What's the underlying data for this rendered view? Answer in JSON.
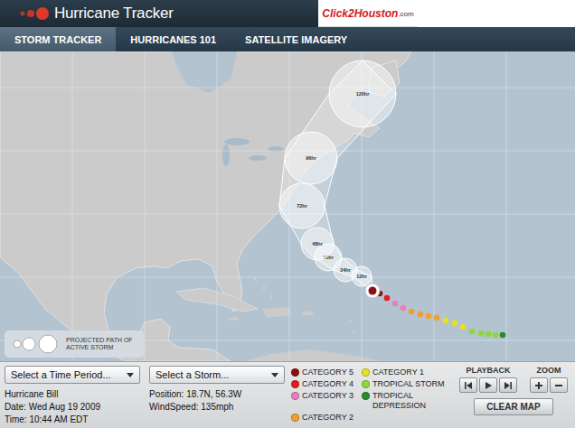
{
  "header": {
    "title": "Hurricane Tracker",
    "logo": {
      "main": "Click2Houston",
      "suffix": ".com"
    }
  },
  "tabs": [
    {
      "label": "STORM TRACKER",
      "selected": true
    },
    {
      "label": "HURRICANES 101",
      "selected": false
    },
    {
      "label": "SATELLITE IMAGERY",
      "selected": false
    }
  ],
  "map": {
    "forecast": [
      {
        "label": "12hr"
      },
      {
        "label": "24hr"
      },
      {
        "label": "36hr"
      },
      {
        "label": "48hr"
      },
      {
        "label": "72hr"
      },
      {
        "label": "96hr"
      },
      {
        "label": "120hr"
      }
    ],
    "track": [
      {
        "color": "#2c8a2c"
      },
      {
        "color": "#8ed83c"
      },
      {
        "color": "#8ed83c"
      },
      {
        "color": "#8ed83c"
      },
      {
        "color": "#8ed83c"
      },
      {
        "color": "#ece01e"
      },
      {
        "color": "#ece01e"
      },
      {
        "color": "#ece01e"
      },
      {
        "color": "#f0a030"
      },
      {
        "color": "#f0a030"
      },
      {
        "color": "#f0a030"
      },
      {
        "color": "#f0a030"
      },
      {
        "color": "#e97dbd"
      },
      {
        "color": "#e97dbd"
      },
      {
        "color": "#e21e1e"
      },
      {
        "color": "#8b1010"
      }
    ],
    "legend": "PROJECTED PATH OF ACTIVE STORM"
  },
  "controls": {
    "time_select": "Select a Time Period...",
    "storm_select": "Select a Storm..."
  },
  "storm": {
    "name": "Hurricane Bill",
    "date": "Date: Wed Aug 19 2009",
    "time": "Time: 10:44 AM EDT",
    "position": "Position: 18.7N, 56.3W",
    "wind": "WindSpeed: 135mph"
  },
  "categories": [
    {
      "label": "CATEGORY 5",
      "color": "#8b1010"
    },
    {
      "label": "CATEGORY 4",
      "color": "#e21e1e"
    },
    {
      "label": "CATEGORY 3",
      "color": "#e97dbd"
    },
    {
      "label": "CATEGORY 2",
      "color": "#f0a030"
    },
    {
      "label": "CATEGORY 1",
      "color": "#ece01e"
    },
    {
      "label": "TROPICAL STORM",
      "color": "#8ed83c"
    },
    {
      "label": "TROPICAL DEPRESSION",
      "color": "#2c8a2c"
    }
  ],
  "playback": {
    "label": "PLAYBACK"
  },
  "zoom": {
    "label": "ZOOM"
  },
  "clear_button": "CLEAR MAP"
}
